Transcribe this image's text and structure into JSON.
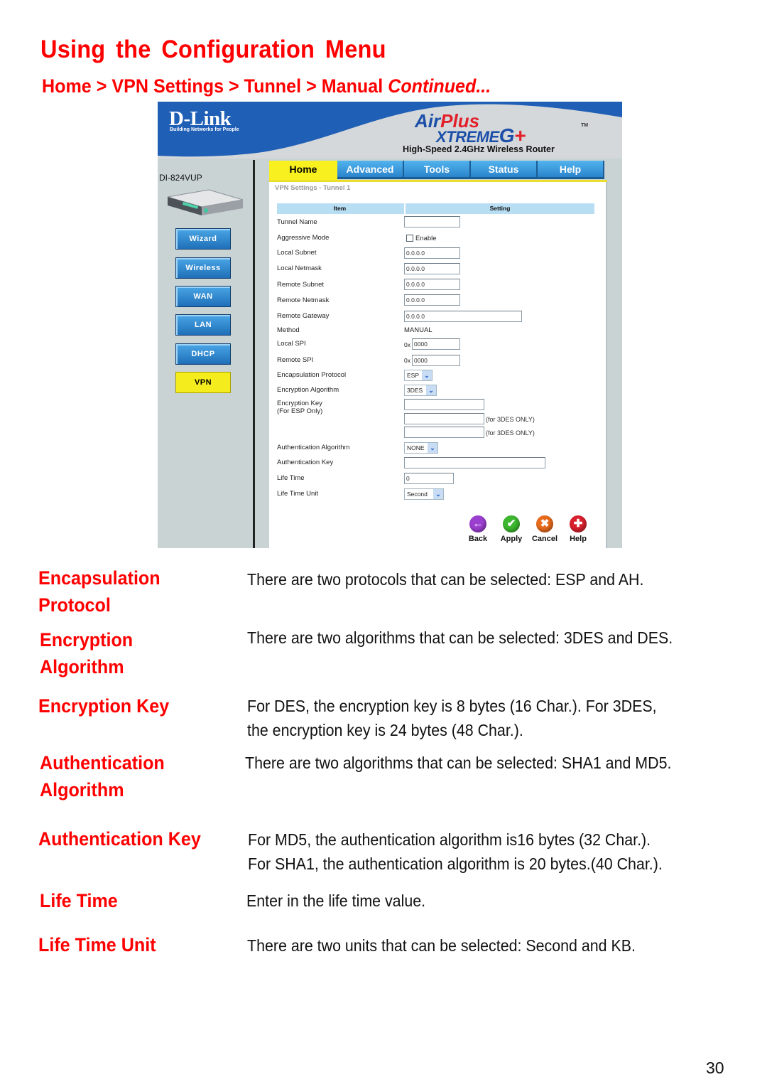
{
  "page": {
    "title": "Using the Configuration Menu",
    "breadcrumb": "Home > VPN Settings > Tunnel > Manual",
    "breadcrumb_suffix": "Continued...",
    "page_number": "30"
  },
  "router_ui": {
    "brand": "D-Link",
    "brand_tagline": "Building Networks for People",
    "product_line_1a": "Air",
    "product_line_1b": "Plus",
    "product_line_2a": "XTREME",
    "product_line_2b": "G",
    "product_line_2c": "+",
    "trademark": "TM",
    "product_tagline": "High-Speed 2.4GHz Wireless Router",
    "model": "DI-824VUP",
    "side_nav": [
      {
        "label": "Wizard",
        "active": false
      },
      {
        "label": "Wireless",
        "active": false
      },
      {
        "label": "WAN",
        "active": false
      },
      {
        "label": "LAN",
        "active": false
      },
      {
        "label": "DHCP",
        "active": false
      },
      {
        "label": "VPN",
        "active": true
      }
    ],
    "tabs": [
      {
        "label": "Home",
        "active": true
      },
      {
        "label": "Advanced",
        "active": false
      },
      {
        "label": "Tools",
        "active": false
      },
      {
        "label": "Status",
        "active": false
      },
      {
        "label": "Help",
        "active": false
      }
    ],
    "panel_title": "VPN Settings - Tunnel 1",
    "table_headers": {
      "item": "Item",
      "setting": "Setting"
    },
    "fields": {
      "tunnel_name": {
        "label": "Tunnel Name",
        "value": ""
      },
      "aggressive_mode": {
        "label": "Aggressive Mode",
        "checkbox_label": "Enable",
        "checked": false
      },
      "local_subnet": {
        "label": "Local Subnet",
        "value": "0.0.0.0"
      },
      "local_netmask": {
        "label": "Local Netmask",
        "value": "0.0.0.0"
      },
      "remote_subnet": {
        "label": "Remote Subnet",
        "value": "0.0.0.0"
      },
      "remote_netmask": {
        "label": "Remote Netmask",
        "value": "0.0.0.0"
      },
      "remote_gateway": {
        "label": "Remote Gateway",
        "value": "0.0.0.0"
      },
      "method": {
        "label": "Method",
        "value": "MANUAL"
      },
      "local_spi": {
        "label": "Local SPI",
        "prefix": "0x",
        "value": "0000"
      },
      "remote_spi": {
        "label": "Remote SPI",
        "prefix": "0x",
        "value": "0000"
      },
      "encapsulation_protocol": {
        "label": "Encapsulation Protocol",
        "value": "ESP"
      },
      "encryption_algorithm": {
        "label": "Encryption Algorithm",
        "value": "3DES"
      },
      "encryption_key": {
        "label": "Encryption Key",
        "sublabel": "(For ESP Only)",
        "value_1": "",
        "value_2": "",
        "value_3": "",
        "hint_2": "(for 3DES ONLY)",
        "hint_3": "(for 3DES ONLY)"
      },
      "authentication_algorithm": {
        "label": "Authentication Algorithm",
        "value": "NONE"
      },
      "authentication_key": {
        "label": "Authentication Key",
        "value": ""
      },
      "life_time": {
        "label": "Life Time",
        "value": "0"
      },
      "life_time_unit": {
        "label": "Life Time Unit",
        "value": "Second"
      }
    },
    "actions": {
      "back": "Back",
      "apply": "Apply",
      "cancel": "Cancel",
      "help": "Help"
    },
    "icons": {
      "back": "←",
      "apply": "✔",
      "cancel": "✖",
      "help": "✚",
      "dropdown": "⌄"
    }
  },
  "descriptions": [
    {
      "term_line1": "Encapsulation",
      "term_line2": "Protocol",
      "text_line1": "There are two protocols that can be selected: ESP and AH.",
      "text_line2": ""
    },
    {
      "term_line1": "Encryption",
      "term_line2": "Algorithm",
      "text_line1": "There are two algorithms that can be selected: 3DES and DES.",
      "text_line2": ""
    },
    {
      "term_line1": "Encryption Key",
      "term_line2": "",
      "text_line1": "For DES, the encryption key is 8 bytes (16 Char.). For 3DES,",
      "text_line2": "the encryption key is  24 bytes (48 Char.)."
    },
    {
      "term_line1": "Authentication",
      "term_line2": "Algorithm",
      "text_line1": "There are two algorithms that can be selected: SHA1 and MD5.",
      "text_line2": ""
    },
    {
      "term_line1": "Authentication Key",
      "term_line2": "",
      "text_line1": "For MD5, the authentication algorithm is16 bytes (32 Char.).",
      "text_line2": "For SHA1, the authentication algorithm is 20 bytes.(40 Char.)."
    },
    {
      "term_line1": "Life Time",
      "term_line2": "",
      "text_line1": "Enter in the life time value.",
      "text_line2": ""
    },
    {
      "term_line1": "Life Time Unit",
      "term_line2": "",
      "text_line1": "There are two units that can be selected: Second and KB.",
      "text_line2": ""
    }
  ],
  "colors": {
    "heading_red": "#ff0000",
    "banner_blue": "#1f5fb5",
    "tab_blue": "#2a84cc",
    "active_yellow": "#f8f01f",
    "table_header_blue": "#b8def4"
  }
}
